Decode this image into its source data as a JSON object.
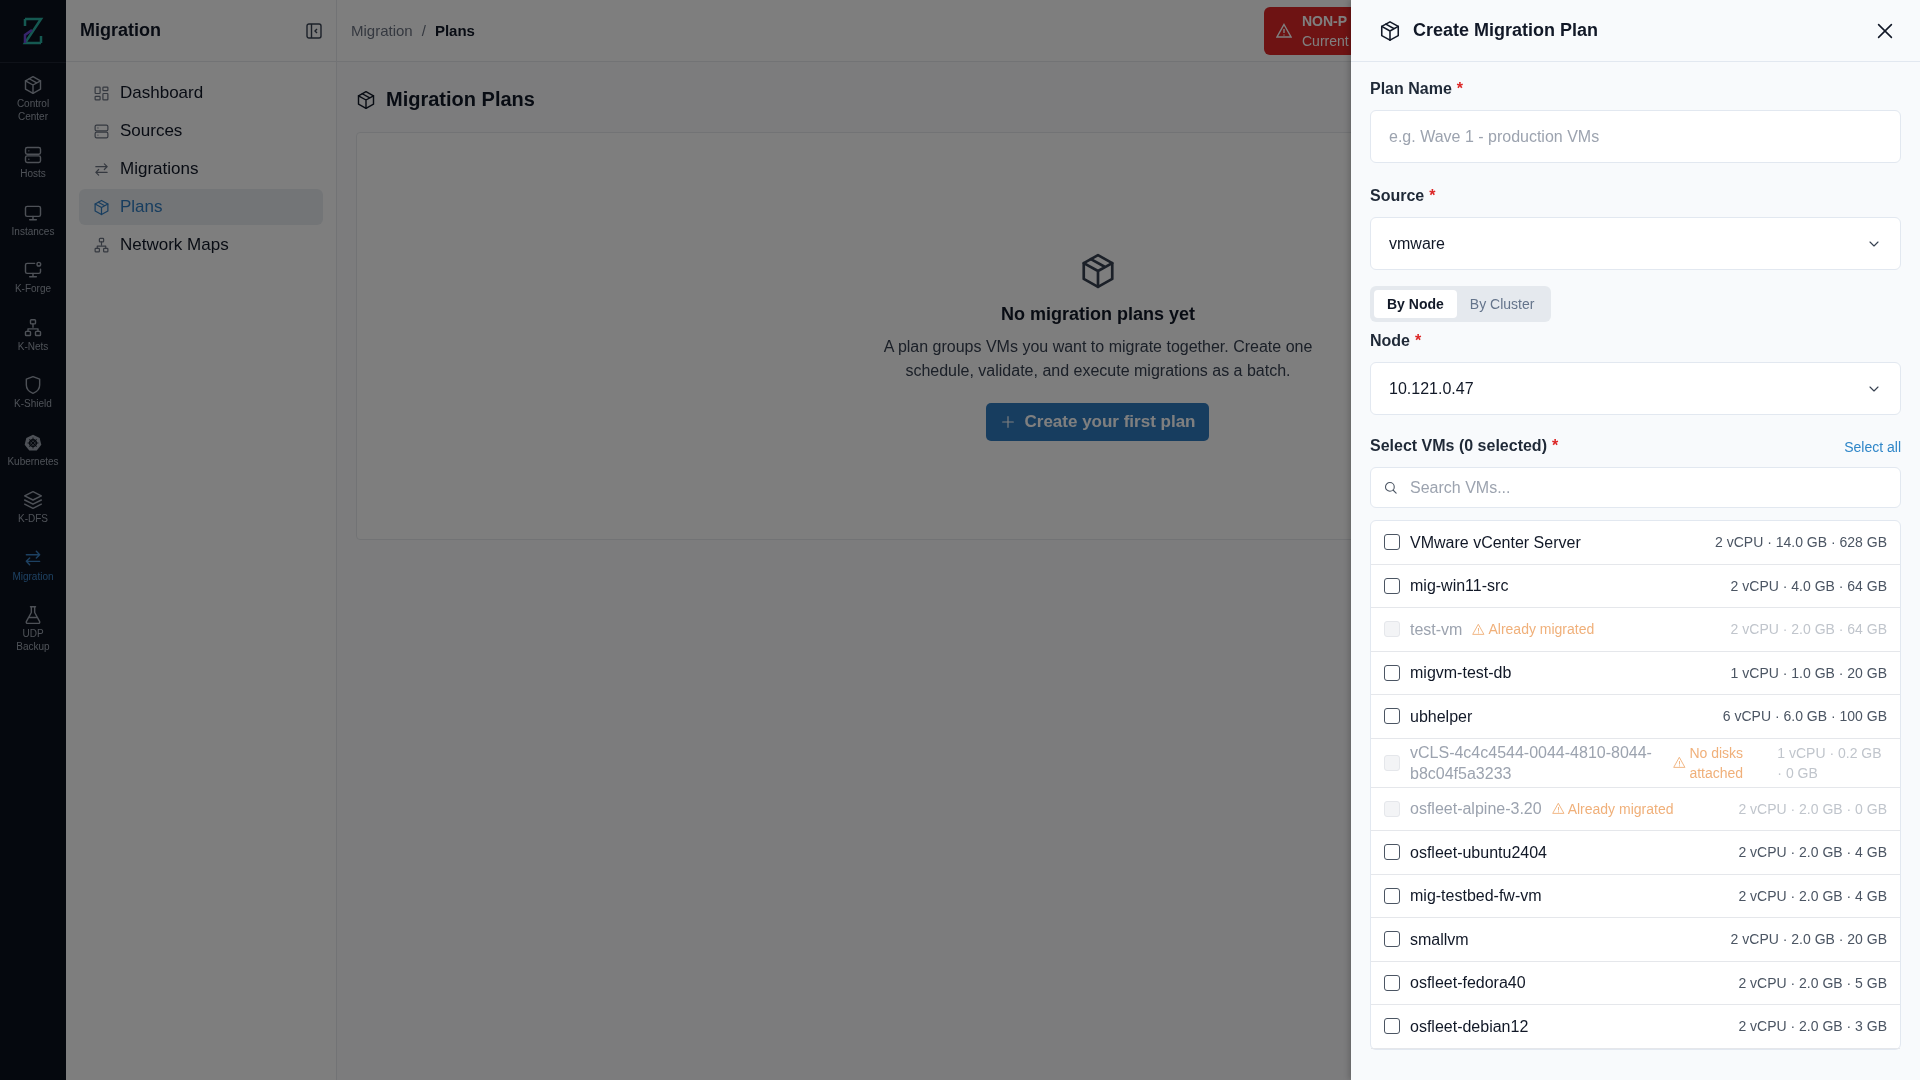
{
  "rail": {
    "items": [
      {
        "label": "Control Center",
        "selected": false
      },
      {
        "label": "Hosts",
        "selected": false
      },
      {
        "label": "Instances",
        "selected": false
      },
      {
        "label": "K-Forge",
        "selected": false
      },
      {
        "label": "K-Nets",
        "selected": false
      },
      {
        "label": "K-Shield",
        "selected": false
      },
      {
        "label": "Kubernetes",
        "selected": false
      },
      {
        "label": "K-DFS",
        "selected": false
      },
      {
        "label": "Migration",
        "selected": true
      },
      {
        "label": "UDP Backup",
        "selected": false
      }
    ]
  },
  "sidebar": {
    "title": "Migration",
    "items": [
      {
        "label": "Dashboard",
        "selected": false
      },
      {
        "label": "Sources",
        "selected": false
      },
      {
        "label": "Migrations",
        "selected": false
      },
      {
        "label": "Plans",
        "selected": true
      },
      {
        "label": "Network Maps",
        "selected": false
      }
    ]
  },
  "header": {
    "breadcrumb": [
      "Migration",
      "Plans"
    ],
    "breadcrumb_separator": "/",
    "alert": {
      "title": "NON-P",
      "text": "Current"
    }
  },
  "page": {
    "title": "Migration Plans",
    "empty_state": {
      "title": "No migration plans yet",
      "description_lines": [
        "A plan groups VMs you want to migrate together. Create one",
        "schedule, validate, and execute migrations as a batch."
      ],
      "button": "Create your first plan"
    }
  },
  "drawer": {
    "title": "Create Migration Plan",
    "plan_name": {
      "label": "Plan Name",
      "required_mark": "*",
      "placeholder": "e.g. Wave 1 - production VMs"
    },
    "source": {
      "label": "Source",
      "required_mark": "*",
      "value": "vmware"
    },
    "mode_tabs": [
      {
        "label": "By Node",
        "selected": true
      },
      {
        "label": "By Cluster",
        "selected": false
      }
    ],
    "node": {
      "label": "Node",
      "required_mark": "*",
      "value": "10.121.0.47"
    },
    "vms": {
      "label": "Select VMs (0 selected)",
      "required_mark": "*",
      "select_all": "Select all",
      "search_placeholder": "Search VMs...",
      "rows": [
        {
          "name": "VMware vCenter Server",
          "specs": "2 vCPU · 14.0 GB · 628 GB",
          "checked": false,
          "disabled": false
        },
        {
          "name": "mig-win11-src",
          "specs": "2 vCPU · 4.0 GB · 64 GB",
          "checked": false,
          "disabled": false
        },
        {
          "name": "test-vm",
          "warning": "Already migrated",
          "specs": "2 vCPU · 2.0 GB · 64 GB",
          "checked": false,
          "disabled": true
        },
        {
          "name": "migvm-test-db",
          "specs": "1 vCPU · 1.0 GB · 20 GB",
          "checked": false,
          "disabled": false
        },
        {
          "name": "ubhelper",
          "specs": "6 vCPU · 6.0 GB · 100 GB",
          "checked": false,
          "disabled": false
        },
        {
          "name": "vCLS-4c4c4544-0044-4810-8044-b8c04f5a3233",
          "warning": "No disks attached",
          "specs": "1 vCPU · 0.2 GB · 0 GB",
          "checked": false,
          "disabled": true
        },
        {
          "name": "osfleet-alpine-3.20",
          "warning": "Already migrated",
          "specs": "2 vCPU · 2.0 GB · 0 GB",
          "checked": false,
          "disabled": true
        },
        {
          "name": "osfleet-ubuntu2404",
          "specs": "2 vCPU · 2.0 GB · 4 GB",
          "checked": false,
          "disabled": false
        },
        {
          "name": "mig-testbed-fw-vm",
          "specs": "2 vCPU · 2.0 GB · 4 GB",
          "checked": false,
          "disabled": false
        },
        {
          "name": "smallvm",
          "specs": "2 vCPU · 2.0 GB · 20 GB",
          "checked": false,
          "disabled": false
        },
        {
          "name": "osfleet-fedora40",
          "specs": "2 vCPU · 2.0 GB · 5 GB",
          "checked": false,
          "disabled": false
        },
        {
          "name": "osfleet-debian12",
          "specs": "2 vCPU · 2.0 GB · 3 GB",
          "checked": false,
          "disabled": false
        }
      ]
    }
  }
}
